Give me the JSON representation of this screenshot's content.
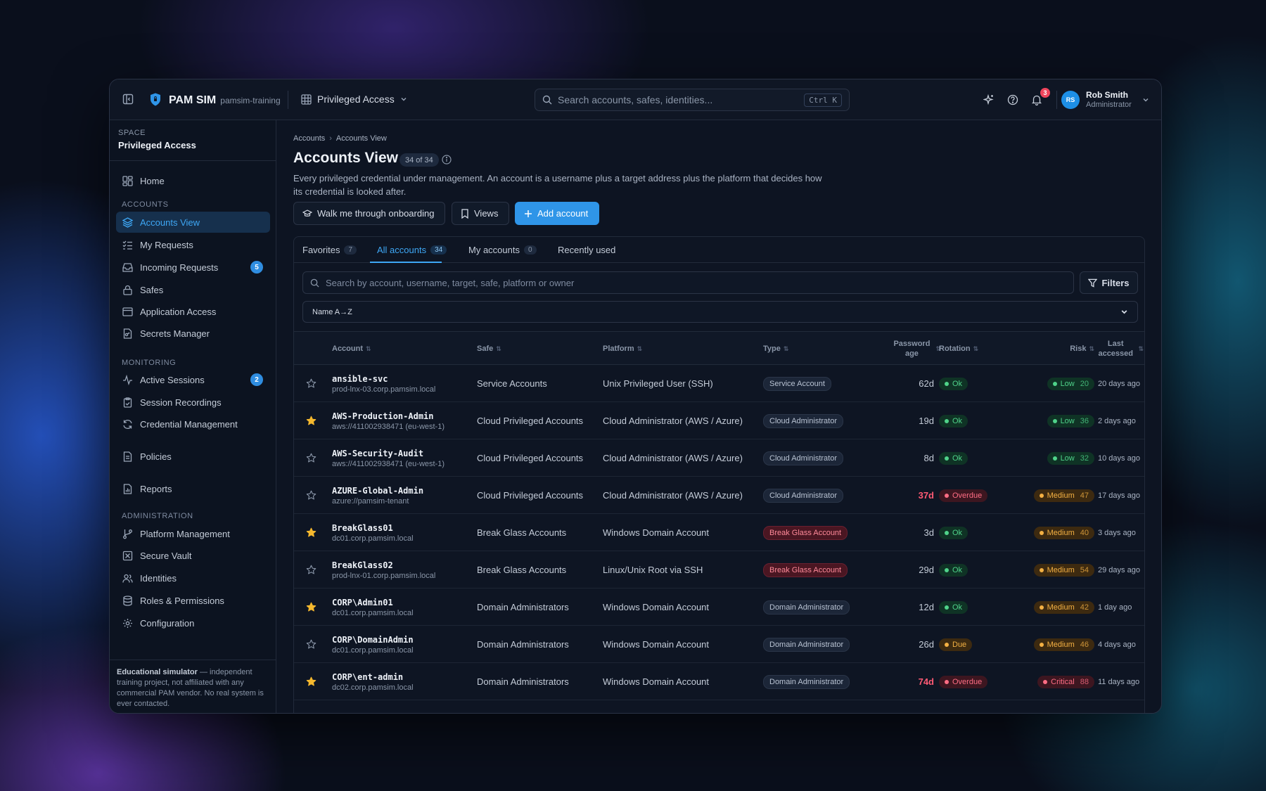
{
  "app": {
    "name": "PAM SIM",
    "tenant": "pamsim-training",
    "space_switch": "Privileged Access",
    "search_placeholder": "Search accounts, safes, identities...",
    "search_shortcut": "Ctrl K",
    "notifications_count": "3",
    "user": {
      "initials": "RS",
      "name": "Rob Smith",
      "role": "Administrator"
    }
  },
  "sidebar": {
    "space_label": "SPACE",
    "space_name": "Privileged Access",
    "home": "Home",
    "sections": {
      "accounts": "ACCOUNTS",
      "monitoring": "MONITORING",
      "administration": "ADMINISTRATION"
    },
    "accounts_items": [
      {
        "label": "Accounts View",
        "icon": "layers-icon",
        "active": true
      },
      {
        "label": "My Requests",
        "icon": "list-check-icon"
      },
      {
        "label": "Incoming Requests",
        "icon": "inbox-icon",
        "badge": "5"
      },
      {
        "label": "Safes",
        "icon": "lock-icon"
      },
      {
        "label": "Application Access",
        "icon": "app-window-icon"
      },
      {
        "label": "Secrets Manager",
        "icon": "file-key-icon"
      }
    ],
    "monitoring_items": [
      {
        "label": "Active Sessions",
        "icon": "activity-icon",
        "badge": "2"
      },
      {
        "label": "Session Recordings",
        "icon": "clipboard-icon"
      },
      {
        "label": "Credential Management",
        "icon": "refresh-icon"
      }
    ],
    "policies": "Policies",
    "reports": "Reports",
    "admin_items": [
      {
        "label": "Platform Management",
        "icon": "git-branch-icon"
      },
      {
        "label": "Secure Vault",
        "icon": "vault-icon"
      },
      {
        "label": "Identities",
        "icon": "users-icon"
      },
      {
        "label": "Roles & Permissions",
        "icon": "database-icon"
      },
      {
        "label": "Configuration",
        "icon": "gear-icon"
      }
    ],
    "footer_bold": "Educational simulator",
    "footer_text": " — independent training project, not affiliated with any commercial PAM vendor. No real system is ever contacted."
  },
  "page": {
    "breadcrumb": [
      "Accounts",
      "Accounts View"
    ],
    "title": "Accounts View",
    "count": "34 of 34",
    "description": "Every privileged credential under management. An account is a username plus a target address plus the platform that decides how its credential is looked after.",
    "buttons": {
      "onboarding": "Walk me through onboarding",
      "views": "Views",
      "add": "Add account"
    }
  },
  "tabs": [
    {
      "label": "Favorites",
      "count": "7"
    },
    {
      "label": "All accounts",
      "count": "34",
      "active": true
    },
    {
      "label": "My accounts",
      "count": "0"
    },
    {
      "label": "Recently used",
      "count": ""
    }
  ],
  "filter": {
    "placeholder": "Search by account, username, target, safe, platform or owner",
    "filters_label": "Filters",
    "sort_value": "Name A→Z"
  },
  "table": {
    "headers": {
      "account": "Account",
      "safe": "Safe",
      "platform": "Platform",
      "type": "Type",
      "password_age": "Password age",
      "rotation": "Rotation",
      "risk": "Risk",
      "last_accessed": "Last accessed"
    },
    "rows": [
      {
        "fav": false,
        "name": "ansible-svc",
        "target": "prod-lnx-03.corp.pamsim.local",
        "safe": "Service Accounts",
        "platform": "Unix Privileged User (SSH)",
        "type": "Service Account",
        "type_kind": "normal",
        "age": "62d",
        "age_overdue": false,
        "rotation": "Ok",
        "rotation_kind": "ok",
        "risk": "Low",
        "risk_score": "20",
        "risk_kind": "low",
        "last": "20 days ago"
      },
      {
        "fav": true,
        "name": "AWS-Production-Admin",
        "target": "aws://411002938471 (eu-west-1)",
        "safe": "Cloud Privileged Accounts",
        "platform": "Cloud Administrator (AWS / Azure)",
        "type": "Cloud Administrator",
        "type_kind": "normal",
        "age": "19d",
        "age_overdue": false,
        "rotation": "Ok",
        "rotation_kind": "ok",
        "risk": "Low",
        "risk_score": "36",
        "risk_kind": "low",
        "last": "2 days ago"
      },
      {
        "fav": false,
        "name": "AWS-Security-Audit",
        "target": "aws://411002938471 (eu-west-1)",
        "safe": "Cloud Privileged Accounts",
        "platform": "Cloud Administrator (AWS / Azure)",
        "type": "Cloud Administrator",
        "type_kind": "normal",
        "age": "8d",
        "age_overdue": false,
        "rotation": "Ok",
        "rotation_kind": "ok",
        "risk": "Low",
        "risk_score": "32",
        "risk_kind": "low",
        "last": "10 days ago"
      },
      {
        "fav": false,
        "name": "AZURE-Global-Admin",
        "target": "azure://pamsim-tenant",
        "safe": "Cloud Privileged Accounts",
        "platform": "Cloud Administrator (AWS / Azure)",
        "type": "Cloud Administrator",
        "type_kind": "normal",
        "age": "37d",
        "age_overdue": true,
        "rotation": "Overdue",
        "rotation_kind": "overdue",
        "risk": "Medium",
        "risk_score": "47",
        "risk_kind": "med",
        "last": "17 days ago"
      },
      {
        "fav": true,
        "name": "BreakGlass01",
        "target": "dc01.corp.pamsim.local",
        "safe": "Break Glass Accounts",
        "platform": "Windows Domain Account",
        "type": "Break Glass Account",
        "type_kind": "bg",
        "age": "3d",
        "age_overdue": false,
        "rotation": "Ok",
        "rotation_kind": "ok",
        "risk": "Medium",
        "risk_score": "40",
        "risk_kind": "med",
        "last": "3 days ago"
      },
      {
        "fav": false,
        "name": "BreakGlass02",
        "target": "prod-lnx-01.corp.pamsim.local",
        "safe": "Break Glass Accounts",
        "platform": "Linux/Unix Root via SSH",
        "type": "Break Glass Account",
        "type_kind": "bg",
        "age": "29d",
        "age_overdue": false,
        "rotation": "Ok",
        "rotation_kind": "ok",
        "risk": "Medium",
        "risk_score": "54",
        "risk_kind": "med",
        "last": "29 days ago"
      },
      {
        "fav": true,
        "name": "CORP\\Admin01",
        "target": "dc01.corp.pamsim.local",
        "safe": "Domain Administrators",
        "platform": "Windows Domain Account",
        "type": "Domain Administrator",
        "type_kind": "normal",
        "age": "12d",
        "age_overdue": false,
        "rotation": "Ok",
        "rotation_kind": "ok",
        "risk": "Medium",
        "risk_score": "42",
        "risk_kind": "med",
        "last": "1 day ago"
      },
      {
        "fav": false,
        "name": "CORP\\DomainAdmin",
        "target": "dc01.corp.pamsim.local",
        "safe": "Domain Administrators",
        "platform": "Windows Domain Account",
        "type": "Domain Administrator",
        "type_kind": "normal",
        "age": "26d",
        "age_overdue": false,
        "rotation": "Due",
        "rotation_kind": "due",
        "risk": "Medium",
        "risk_score": "46",
        "risk_kind": "med",
        "last": "4 days ago"
      },
      {
        "fav": true,
        "name": "CORP\\ent-admin",
        "target": "dc02.corp.pamsim.local",
        "safe": "Domain Administrators",
        "platform": "Windows Domain Account",
        "type": "Domain Administrator",
        "type_kind": "normal",
        "age": "74d",
        "age_overdue": true,
        "rotation": "Overdue",
        "rotation_kind": "overdue",
        "risk": "Critical",
        "risk_score": "88",
        "risk_kind": "crit",
        "last": "11 days ago"
      }
    ]
  },
  "colors": {
    "accent": "#3ea7f5",
    "primary_button": "#2f95e8",
    "ok": "#4fd38a",
    "warn": "#f3b043",
    "danger": "#ff6d84",
    "star": "#f5b82e"
  }
}
